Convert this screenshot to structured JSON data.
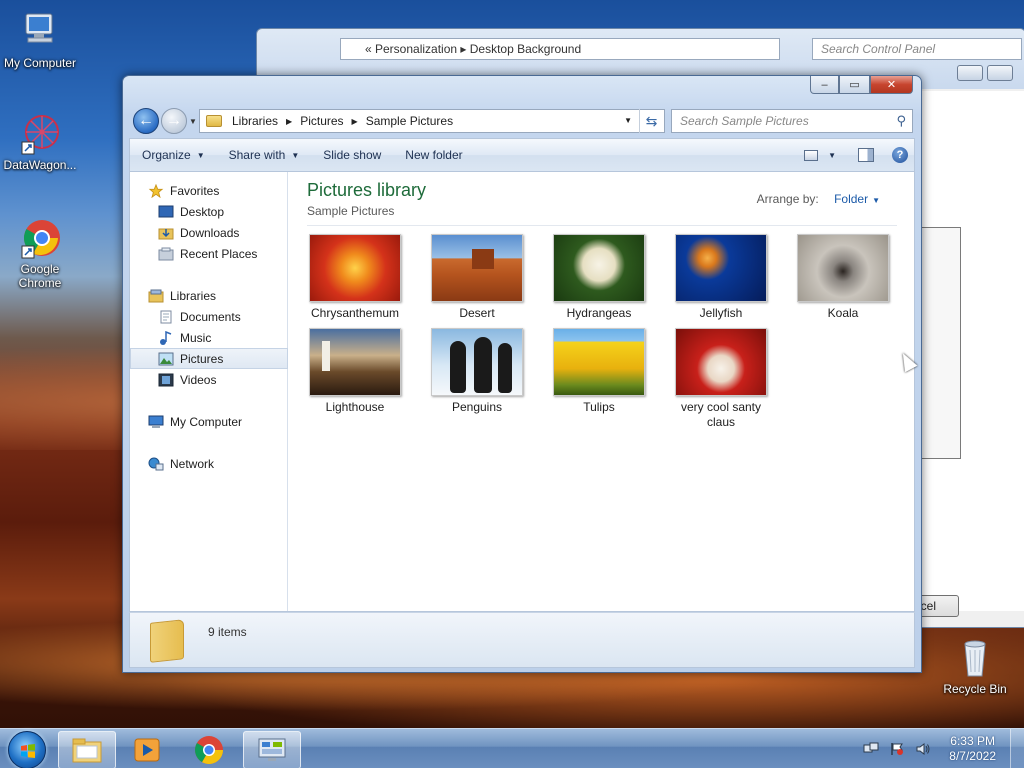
{
  "desktop": {
    "icons": [
      {
        "label": "My Computer"
      },
      {
        "label": "DataWagon..."
      },
      {
        "label": "Google Chrome"
      },
      {
        "label": "Recycle Bin"
      }
    ]
  },
  "back_window": {
    "breadcrumb": "« Personalization ▸ Desktop Background",
    "search_placeholder": "Search Control Panel",
    "cancel_label": "ncel"
  },
  "window": {
    "caption": {
      "minimize": "–",
      "maximize": "▭",
      "close": "✕"
    },
    "address": {
      "crumbs": [
        "Libraries",
        "Pictures",
        "Sample Pictures"
      ]
    },
    "search_placeholder": "Search Sample Pictures",
    "toolbar": {
      "organize": "Organize",
      "share_with": "Share with",
      "slide_show": "Slide show",
      "new_folder": "New folder",
      "help": "?"
    },
    "nav": {
      "favorites": "Favorites",
      "desktop": "Desktop",
      "downloads": "Downloads",
      "recent_places": "Recent Places",
      "libraries": "Libraries",
      "documents": "Documents",
      "music": "Music",
      "pictures": "Pictures",
      "videos": "Videos",
      "my_computer": "My Computer",
      "network": "Network"
    },
    "library": {
      "title": "Pictures library",
      "subtitle": "Sample Pictures",
      "arrange_label": "Arrange by:",
      "arrange_value": "Folder"
    },
    "files": [
      {
        "name": "Chrysanthemum"
      },
      {
        "name": "Desert"
      },
      {
        "name": "Hydrangeas"
      },
      {
        "name": "Jellyfish"
      },
      {
        "name": "Koala"
      },
      {
        "name": "Lighthouse"
      },
      {
        "name": "Penguins"
      },
      {
        "name": "Tulips"
      },
      {
        "name": "very cool santy claus"
      }
    ],
    "details": {
      "count": "9 items"
    }
  },
  "taskbar": {
    "clock_time": "6:33 PM",
    "clock_date": "8/7/2022"
  },
  "colors": {
    "library_title": "#1e6b3a",
    "link_blue": "#1b5aa8",
    "close_red": "#c7452f"
  }
}
